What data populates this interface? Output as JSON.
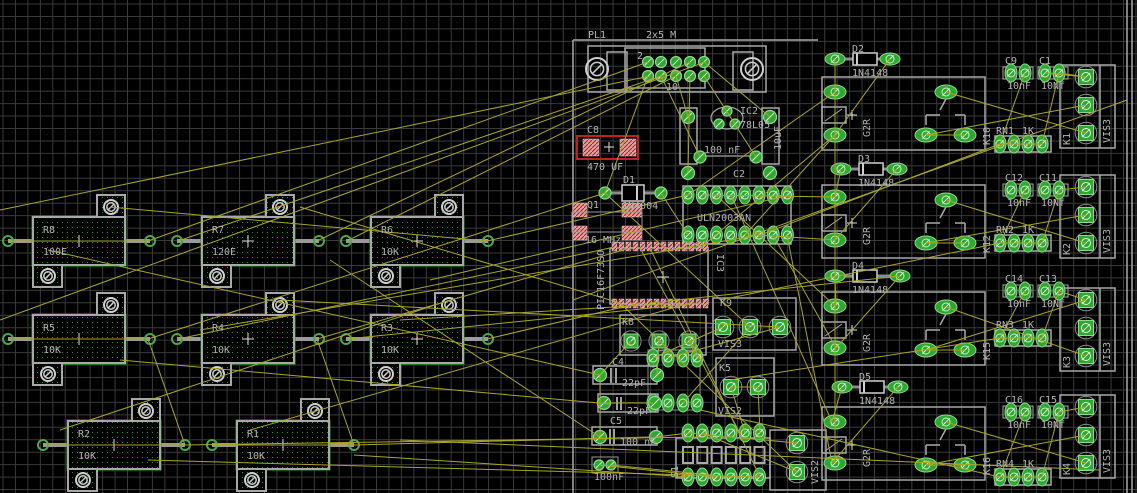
{
  "colors": {
    "background": "#000000",
    "grid": "#3a3a3a",
    "outline": "#a8a8a8",
    "pad": "#2fa82f",
    "pad_ring": "#8fd88f",
    "airwire": "#a7a629",
    "part_outline_green": "#1f9a1f",
    "smd_pad": "#d9a0a0",
    "selected": "#c02020"
  },
  "board": {
    "resistors": [
      {
        "ref": "R8",
        "value": "100E"
      },
      {
        "ref": "R7",
        "value": "120E"
      },
      {
        "ref": "R6",
        "value": "10K"
      },
      {
        "ref": "R5",
        "value": "10K"
      },
      {
        "ref": "R4",
        "value": "10K"
      },
      {
        "ref": "R3",
        "value": "10K"
      },
      {
        "ref": "R2",
        "value": "10K"
      },
      {
        "ref": "R1",
        "value": "10K"
      }
    ],
    "connector": {
      "ref": "PL1",
      "value": "2x5 M",
      "pin_first": "2",
      "pin_last": "10"
    },
    "regulator": {
      "ref": "IC2",
      "value": "78L05"
    },
    "c_bulk": {
      "ref": "C8",
      "value": "470 UF"
    },
    "c_reg": {
      "ref": "C2",
      "value": "100 nF"
    },
    "c_reg_out": {
      "ref": "C",
      "value": "10uF"
    },
    "diode_main": {
      "ref": "D1",
      "value": "1N4004"
    },
    "crystal": {
      "ref": "Q1",
      "value": "16 MHz"
    },
    "driver": {
      "value": "ULN2003AN"
    },
    "mcu": {
      "ref": "IC3",
      "value": "PIC16F73SO"
    },
    "k9": {
      "ref": "K9",
      "value": "VIS3"
    },
    "k8": {
      "ref": "K8"
    },
    "c4": {
      "ref": "C4",
      "value": "22pF"
    },
    "c5": {
      "ref": "C5",
      "value": "22pF"
    },
    "c_dec": {
      "value": "100 nF"
    },
    "c_small": {
      "value": "100nF"
    },
    "k5": {
      "ref": "K5",
      "value": "VIS2"
    },
    "dip": {
      "ref": "S1"
    },
    "k7": {
      "value": "VIS2"
    },
    "diodes": [
      {
        "ref": "D2",
        "value": "1N4148"
      },
      {
        "ref": "D3",
        "value": "1N4148"
      },
      {
        "ref": "D4",
        "value": "1N4148"
      },
      {
        "ref": "D5",
        "value": "1N4148"
      }
    ],
    "relays": [
      {
        "ref": "K10",
        "value": "G2R"
      },
      {
        "ref": "K12",
        "value": "G2R"
      },
      {
        "ref": "K15",
        "value": "G2R"
      },
      {
        "ref": "K16",
        "value": "G2R"
      }
    ],
    "terminals": [
      {
        "ref": "K1",
        "value": "VIS3"
      },
      {
        "ref": "K2",
        "value": "VIS3"
      },
      {
        "ref": "K3",
        "value": "VIS3"
      },
      {
        "ref": "K4",
        "value": "VIS3"
      }
    ],
    "cap_pairs": [
      [
        {
          "ref": "C9",
          "value": "10nF"
        },
        {
          "ref": "C1",
          "value": "10Nf"
        }
      ],
      [
        {
          "ref": "C12",
          "value": "10nF"
        },
        {
          "ref": "C11",
          "value": "10Nf"
        }
      ],
      [
        {
          "ref": "C14",
          "value": "10nF"
        },
        {
          "ref": "C13",
          "value": "10Nf"
        }
      ],
      [
        {
          "ref": "C16",
          "value": "10nF"
        },
        {
          "ref": "C15",
          "value": "10Nf"
        }
      ]
    ],
    "resnets": [
      {
        "ref": "RN1",
        "value": "1K"
      },
      {
        "ref": "RN2",
        "value": "1K"
      },
      {
        "ref": "RN3",
        "value": "1K"
      },
      {
        "ref": "RN4",
        "value": "1K"
      }
    ]
  }
}
